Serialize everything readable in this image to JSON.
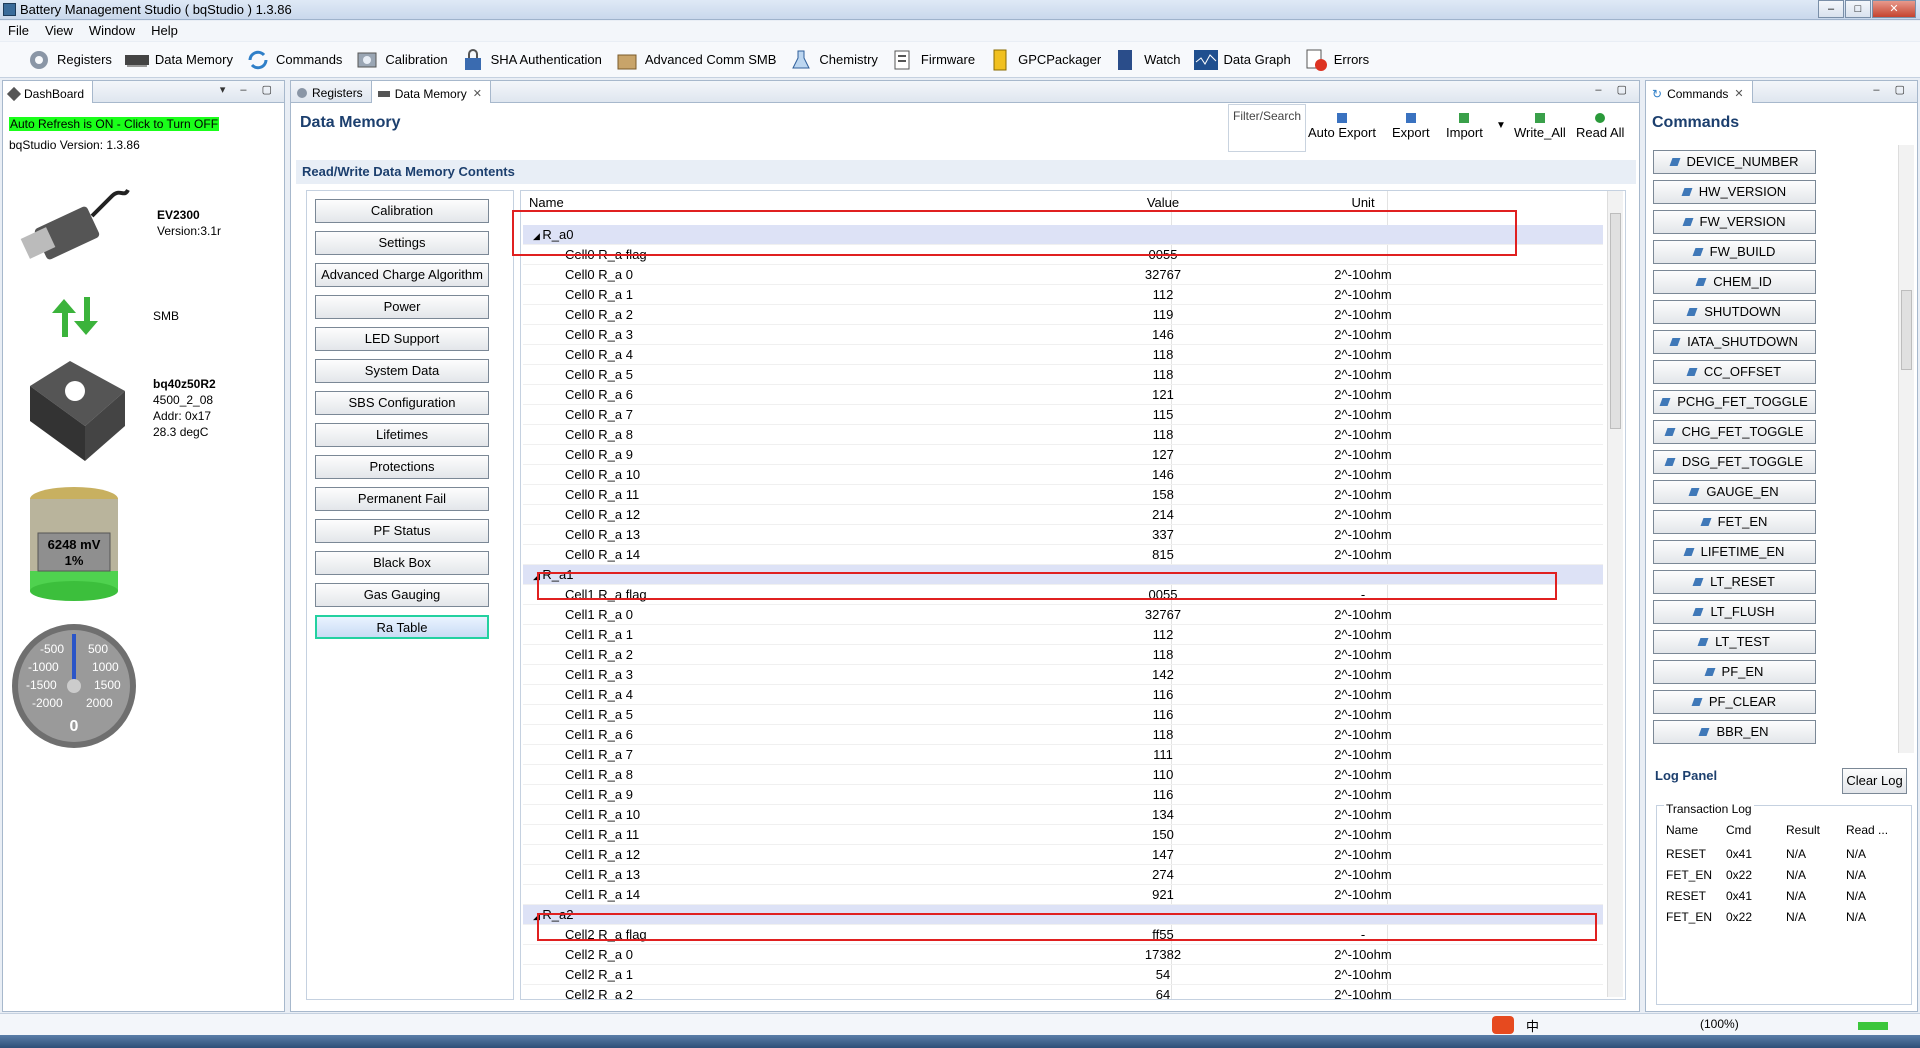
{
  "window": {
    "title": "Battery Management Studio ( bqStudio ) 1.3.86"
  },
  "menu": [
    "File",
    "View",
    "Window",
    "Help"
  ],
  "toolbar": [
    {
      "label": "Registers",
      "icon": "gear-icon"
    },
    {
      "label": "Data Memory",
      "icon": "memory-chip-icon"
    },
    {
      "label": "Commands",
      "icon": "refresh-arrows-icon"
    },
    {
      "label": "Calibration",
      "icon": "calibration-icon"
    },
    {
      "label": "SHA Authentication",
      "icon": "padlock-icon"
    },
    {
      "label": "Advanced Comm SMB",
      "icon": "box-icon"
    },
    {
      "label": "Chemistry",
      "icon": "flask-icon"
    },
    {
      "label": "Firmware",
      "icon": "firmware-icon"
    },
    {
      "label": "GPCPackager",
      "icon": "package-icon"
    },
    {
      "label": "Watch",
      "icon": "book-icon"
    },
    {
      "label": "Data Graph",
      "icon": "graph-icon"
    },
    {
      "label": "Errors",
      "icon": "error-icon"
    }
  ],
  "dashboard": {
    "tab": "DashBoard",
    "auto_refresh": "Auto Refresh is ON - Click to Turn OFF",
    "version": "bqStudio Version:  1.3.86",
    "adapter_name": "EV2300",
    "adapter_version": "Version:3.1r",
    "bus": "SMB",
    "device_name": "bq40z50R2",
    "device_fw": "4500_2_08",
    "device_addr": "Addr: 0x17",
    "device_temp": "28.3 degC",
    "battery_voltage": "6248 mV",
    "battery_soc": "1%",
    "gauge_labels": [
      "-500",
      "500",
      "-1000",
      "1000",
      "-1500",
      "1500",
      "-2000",
      "2000"
    ],
    "gauge_value": "0"
  },
  "editor_tabs": [
    {
      "label": "Registers"
    },
    {
      "label": "Data Memory"
    }
  ],
  "data_memory": {
    "title": "Data Memory",
    "filter_placeholder": "Filter/Search",
    "buttons": [
      "Auto Export",
      "Export",
      "Import",
      "Write_All",
      "Read All"
    ],
    "section_label": "Read/Write Data Memory Contents",
    "nav": [
      "Calibration",
      "Settings",
      "Advanced Charge Algorithm",
      "Power",
      "LED Support",
      "System Data",
      "SBS Configuration",
      "Lifetimes",
      "Protections",
      "Permanent Fail",
      "PF Status",
      "Black Box",
      "Gas Gauging",
      "Ra Table"
    ],
    "selected_nav": "Ra Table",
    "columns": {
      "name": "Name",
      "value": "Value",
      "unit": "Unit"
    },
    "rows": [
      {
        "group": true,
        "name": "R_a0"
      },
      {
        "name": "Cell0 R_a flag",
        "value": "0055",
        "unit": "-"
      },
      {
        "name": "Cell0 R_a 0",
        "value": "32767",
        "unit": "2^-10ohm"
      },
      {
        "name": "Cell0 R_a 1",
        "value": "112",
        "unit": "2^-10ohm"
      },
      {
        "name": "Cell0 R_a 2",
        "value": "119",
        "unit": "2^-10ohm"
      },
      {
        "name": "Cell0 R_a 3",
        "value": "146",
        "unit": "2^-10ohm"
      },
      {
        "name": "Cell0 R_a 4",
        "value": "118",
        "unit": "2^-10ohm"
      },
      {
        "name": "Cell0 R_a 5",
        "value": "118",
        "unit": "2^-10ohm"
      },
      {
        "name": "Cell0 R_a 6",
        "value": "121",
        "unit": "2^-10ohm"
      },
      {
        "name": "Cell0 R_a 7",
        "value": "115",
        "unit": "2^-10ohm"
      },
      {
        "name": "Cell0 R_a 8",
        "value": "118",
        "unit": "2^-10ohm"
      },
      {
        "name": "Cell0 R_a 9",
        "value": "127",
        "unit": "2^-10ohm"
      },
      {
        "name": "Cell0 R_a 10",
        "value": "146",
        "unit": "2^-10ohm"
      },
      {
        "name": "Cell0 R_a 11",
        "value": "158",
        "unit": "2^-10ohm"
      },
      {
        "name": "Cell0 R_a 12",
        "value": "214",
        "unit": "2^-10ohm"
      },
      {
        "name": "Cell0 R_a 13",
        "value": "337",
        "unit": "2^-10ohm"
      },
      {
        "name": "Cell0 R_a 14",
        "value": "815",
        "unit": "2^-10ohm"
      },
      {
        "group": true,
        "name": "R_a1"
      },
      {
        "name": "Cell1 R_a flag",
        "value": "0055",
        "unit": "-"
      },
      {
        "name": "Cell1 R_a 0",
        "value": "32767",
        "unit": "2^-10ohm"
      },
      {
        "name": "Cell1 R_a 1",
        "value": "112",
        "unit": "2^-10ohm"
      },
      {
        "name": "Cell1 R_a 2",
        "value": "118",
        "unit": "2^-10ohm"
      },
      {
        "name": "Cell1 R_a 3",
        "value": "142",
        "unit": "2^-10ohm"
      },
      {
        "name": "Cell1 R_a 4",
        "value": "116",
        "unit": "2^-10ohm"
      },
      {
        "name": "Cell1 R_a 5",
        "value": "116",
        "unit": "2^-10ohm"
      },
      {
        "name": "Cell1 R_a 6",
        "value": "118",
        "unit": "2^-10ohm"
      },
      {
        "name": "Cell1 R_a 7",
        "value": "111",
        "unit": "2^-10ohm"
      },
      {
        "name": "Cell1 R_a 8",
        "value": "110",
        "unit": "2^-10ohm"
      },
      {
        "name": "Cell1 R_a 9",
        "value": "116",
        "unit": "2^-10ohm"
      },
      {
        "name": "Cell1 R_a 10",
        "value": "134",
        "unit": "2^-10ohm"
      },
      {
        "name": "Cell1 R_a 11",
        "value": "150",
        "unit": "2^-10ohm"
      },
      {
        "name": "Cell1 R_a 12",
        "value": "147",
        "unit": "2^-10ohm"
      },
      {
        "name": "Cell1 R_a 13",
        "value": "274",
        "unit": "2^-10ohm"
      },
      {
        "name": "Cell1 R_a 14",
        "value": "921",
        "unit": "2^-10ohm"
      },
      {
        "group": true,
        "name": "R_a2"
      },
      {
        "name": "Cell2 R_a flag",
        "value": "ff55",
        "unit": "-"
      },
      {
        "name": "Cell2 R_a 0",
        "value": "17382",
        "unit": "2^-10ohm"
      },
      {
        "name": "Cell2 R_a 1",
        "value": "54",
        "unit": "2^-10ohm"
      },
      {
        "name": "Cell2 R_a 2",
        "value": "64",
        "unit": "2^-10ohm"
      }
    ]
  },
  "commands": {
    "tab": "Commands",
    "title": "Commands",
    "buttons": [
      "DEVICE_NUMBER",
      "HW_VERSION",
      "FW_VERSION",
      "FW_BUILD",
      "CHEM_ID",
      "SHUTDOWN",
      "IATA_SHUTDOWN",
      "CC_OFFSET",
      "PCHG_FET_TOGGLE",
      "CHG_FET_TOGGLE",
      "DSG_FET_TOGGLE",
      "GAUGE_EN",
      "FET_EN",
      "LIFETIME_EN",
      "LT_RESET",
      "LT_FLUSH",
      "LT_TEST",
      "PF_EN",
      "PF_CLEAR",
      "BBR_EN"
    ]
  },
  "log": {
    "title": "Log Panel",
    "clear": "Clear Log",
    "group": "Transaction Log",
    "headers": [
      "Name",
      "Cmd",
      "Result",
      "Read ..."
    ],
    "rows": [
      [
        "RESET",
        "0x41",
        "N/A",
        "N/A"
      ],
      [
        "FET_EN",
        "0x22",
        "N/A",
        "N/A"
      ],
      [
        "RESET",
        "0x41",
        "N/A",
        "N/A"
      ],
      [
        "FET_EN",
        "0x22",
        "N/A",
        "N/A"
      ]
    ]
  },
  "status": {
    "zoom": "(100%)",
    "ime": "中"
  },
  "colors": {
    "highlight": "#e02020",
    "auto_refresh_bg": "#1aff1a",
    "heading": "#1c3f6e",
    "group_row": "#dde2f6"
  }
}
